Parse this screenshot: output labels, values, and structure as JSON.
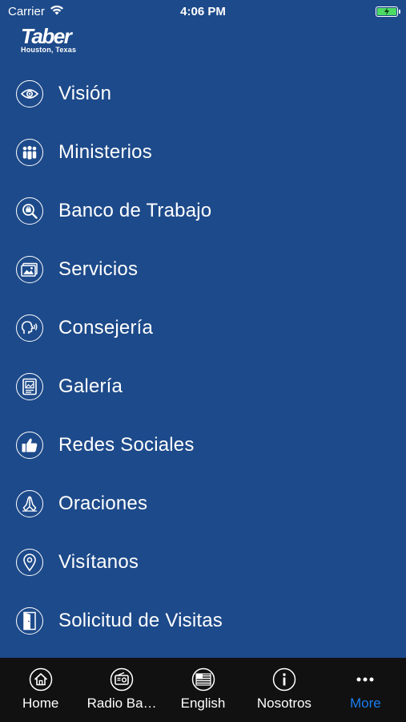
{
  "status_bar": {
    "carrier": "Carrier",
    "time": "4:06 PM"
  },
  "header": {
    "logo_title": "Taber",
    "logo_subtitle": "Houston, Texas"
  },
  "menu": {
    "items": [
      {
        "label": "Visión",
        "icon": "eye-icon"
      },
      {
        "label": "Ministerios",
        "icon": "people-icon"
      },
      {
        "label": "Banco de Trabajo",
        "icon": "search-icon"
      },
      {
        "label": "Servicios",
        "icon": "image-icon"
      },
      {
        "label": "Consejería",
        "icon": "speaking-head-icon"
      },
      {
        "label": "Galería",
        "icon": "gallery-icon"
      },
      {
        "label": "Redes Sociales",
        "icon": "thumbs-up-icon"
      },
      {
        "label": "Oraciones",
        "icon": "praying-hands-icon"
      },
      {
        "label": "Visítanos",
        "icon": "location-pin-icon"
      },
      {
        "label": "Solicitud de Visitas",
        "icon": "door-icon"
      }
    ]
  },
  "tab_bar": {
    "tabs": [
      {
        "label": "Home",
        "icon": "home-icon"
      },
      {
        "label": "Radio Ba…",
        "icon": "radio-icon"
      },
      {
        "label": "English",
        "icon": "us-flag-icon"
      },
      {
        "label": "Nosotros",
        "icon": "info-icon"
      },
      {
        "label": "More",
        "icon": "more-icon",
        "active": true
      }
    ],
    "active_color": "#1a7df0"
  },
  "colors": {
    "background": "#1d4a8a",
    "tab_bar": "#111111",
    "battery": "#4cd964"
  }
}
